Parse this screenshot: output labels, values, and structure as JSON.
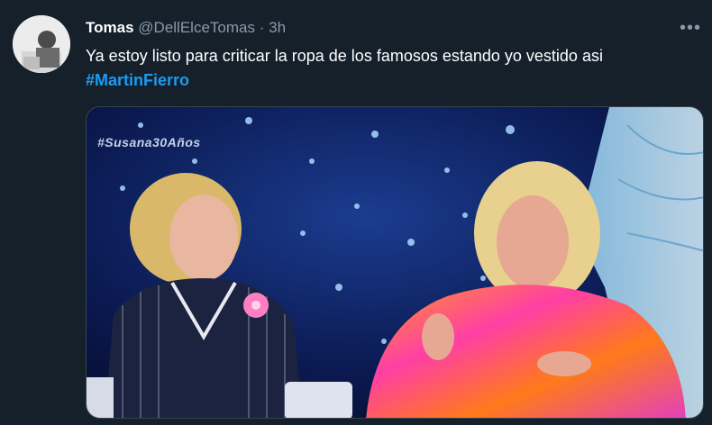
{
  "tweet": {
    "display_name": "Tomas",
    "handle": "@DellElceTomas",
    "separator": "·",
    "time": "3h",
    "more_icon": "more-horizontal-icon",
    "text": "Ya estoy listo para criticar la ropa de los famosos estando yo vestido asi",
    "hashtag": "#MartinFierro",
    "hashtag_color": "#1d9bf0"
  },
  "media": {
    "watermark": "#Susana30Años"
  },
  "colors": {
    "background": "#15202b",
    "secondary_text": "#8899a6"
  }
}
